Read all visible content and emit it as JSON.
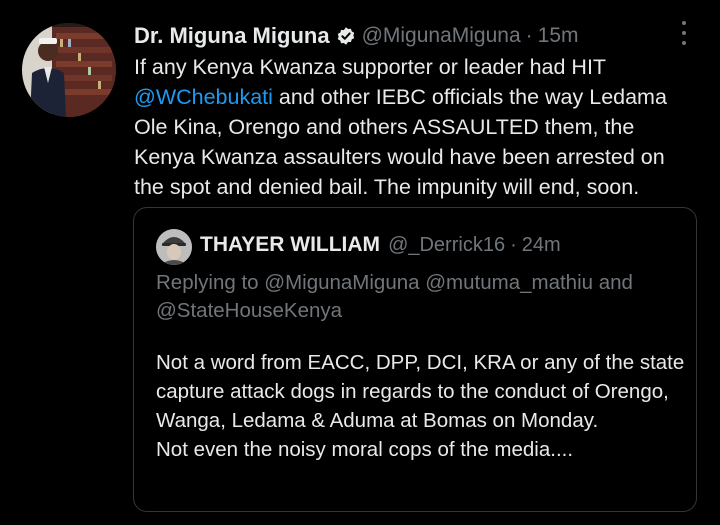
{
  "tweet": {
    "author_name": "Dr. Miguna Miguna",
    "author_handle": "@MigunaMiguna",
    "separator": "·",
    "timestamp": "15m",
    "text_before_mention": "If any Kenya Kwanza supporter or leader had HIT ",
    "mention": "@WChebukati",
    "text_after_mention": " and other IEBC officials the way Ledama Ole Kina, Orengo and others ASSAULTED them, the Kenya Kwanza assaulters would have been arrested on the spot and denied bail. The impunity will end, soon.",
    "verified_icon": "verified-badge-icon",
    "more_icon": "more-vertical-icon"
  },
  "quoted_tweet": {
    "author_name": "THAYER WILLIAM",
    "author_handle": "@_Derrick16",
    "separator": "·",
    "timestamp": "24m",
    "replying_to": "Replying to @MigunaMiguna @mutuma_mathiu and @StateHouseKenya",
    "text": "Not a word from EACC,  DPP,  DCI,  KRA or any of the state capture attack dogs in regards to the conduct of Orengo,  Wanga,  Ledama &  Aduma at Bomas on Monday.\nNot even the noisy moral cops of the media...."
  },
  "colors": {
    "background": "#000000",
    "text_primary": "#e7e9ea",
    "text_secondary": "#71767b",
    "link": "#1d9bf0",
    "border": "#333639"
  }
}
